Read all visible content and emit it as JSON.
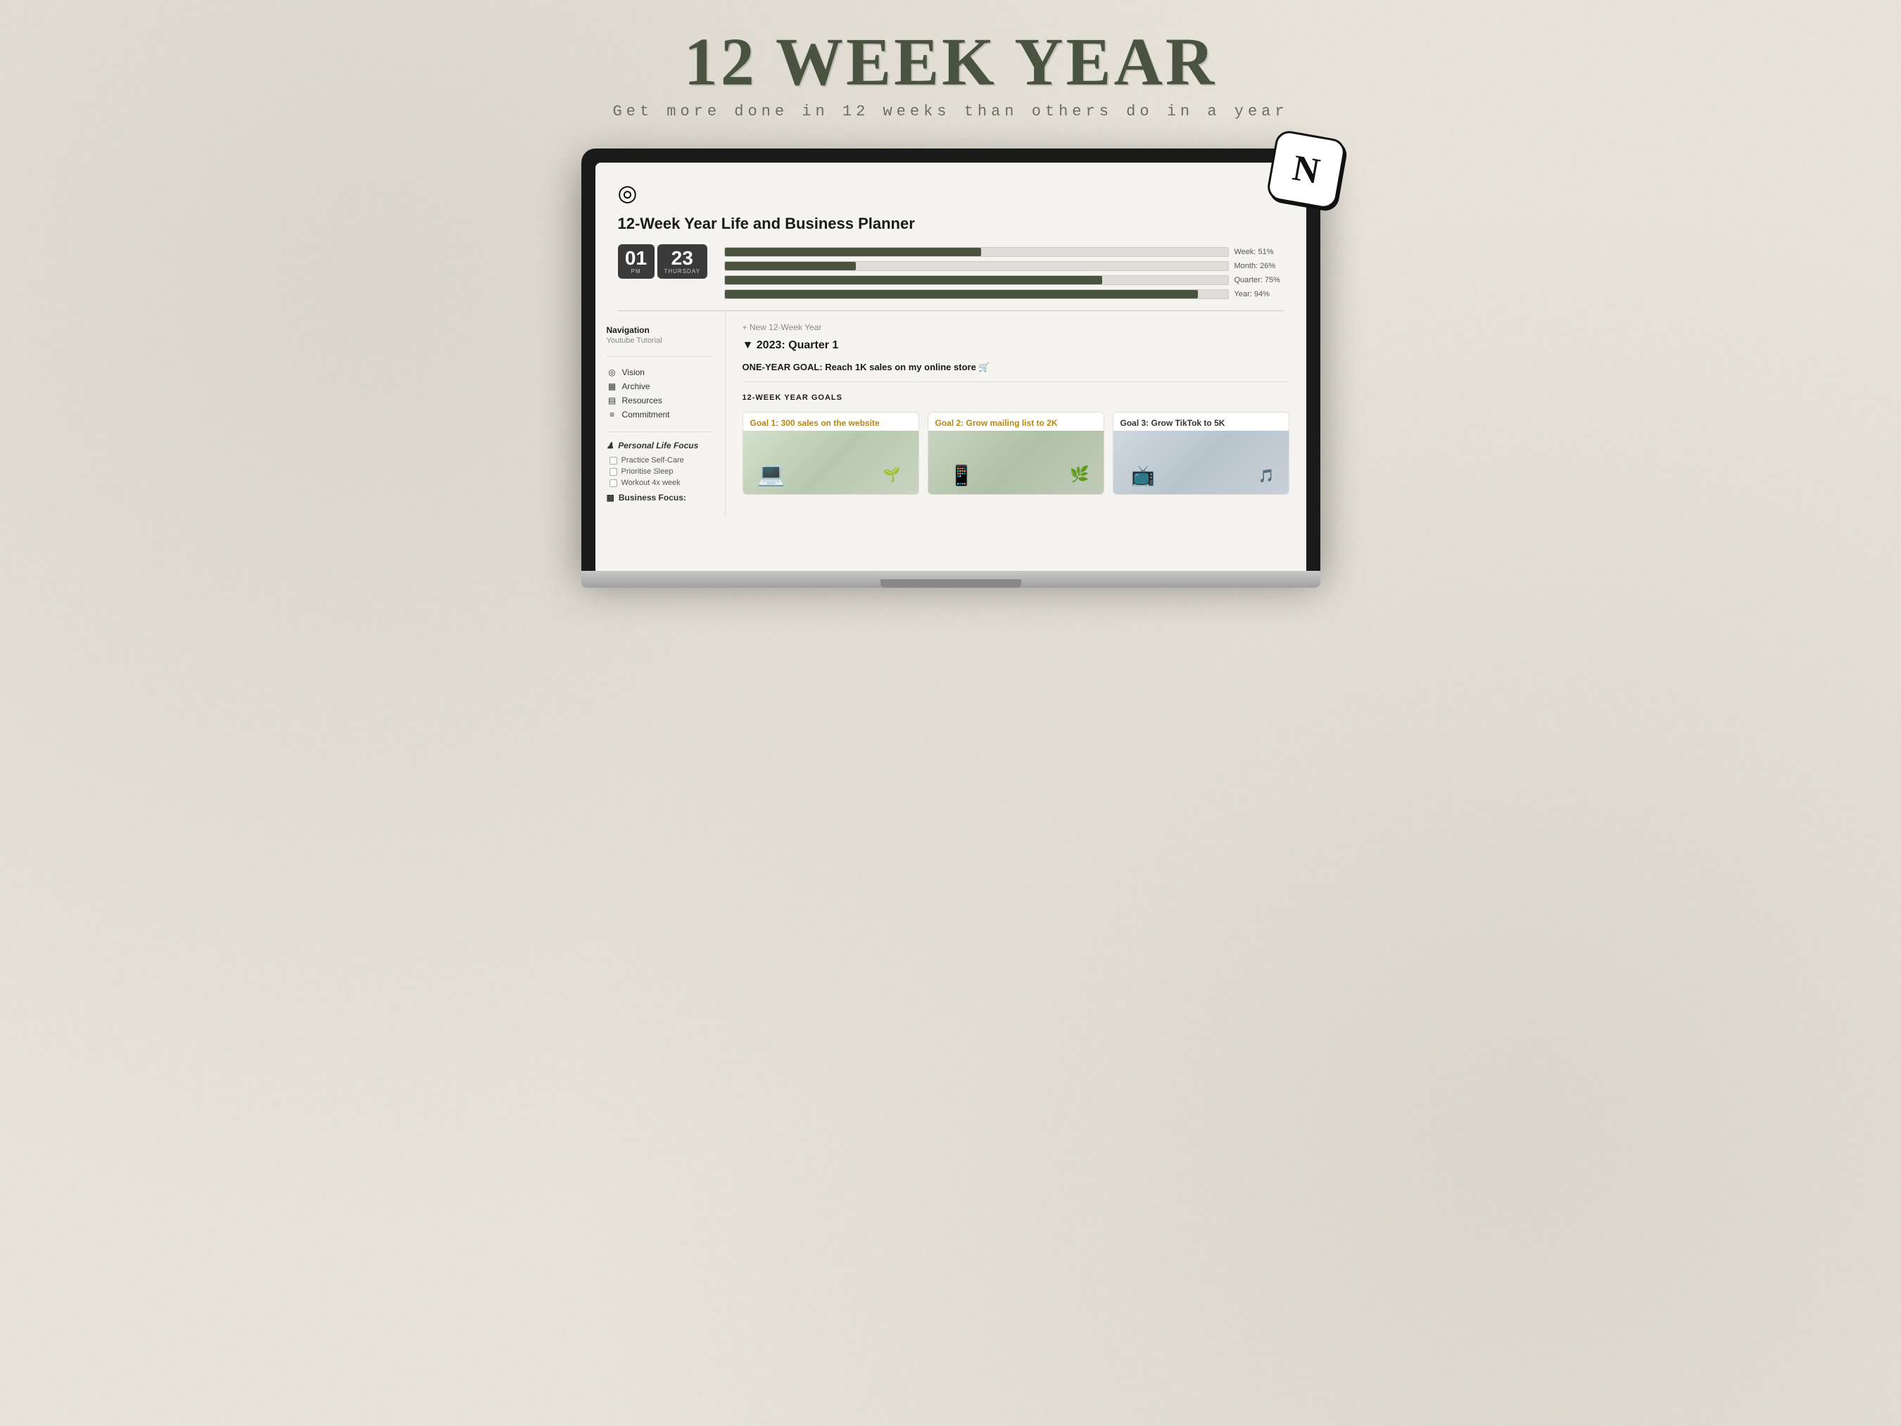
{
  "header": {
    "main_title": "12 WEEK YEAR",
    "subtitle": "Get more done in 12 weeks than others do in a year"
  },
  "notion_badge": "N",
  "app": {
    "target_icon": "◎",
    "title": "12-Week Year  Life and Business Planner",
    "clock": {
      "hour": "01",
      "hour_label": "PM",
      "minute": "23",
      "minute_label": "THURSDAY"
    },
    "progress": [
      {
        "label": "Week: 51%",
        "percent": 51
      },
      {
        "label": "Month: 26%",
        "percent": 26
      },
      {
        "label": "Quarter: 75%",
        "percent": 75
      },
      {
        "label": "Year: 94%",
        "percent": 94
      }
    ],
    "sidebar": {
      "nav_heading": "Navigation",
      "nav_subheading": "Youtube Tutorial",
      "items": [
        {
          "icon": "◎",
          "label": "Vision"
        },
        {
          "icon": "▦",
          "label": "Archive"
        },
        {
          "icon": "▤",
          "label": "Resources"
        },
        {
          "icon": "≡",
          "label": "Commitment"
        }
      ],
      "personal_life_focus": {
        "title": "Personal Life Focus",
        "icon": "♟",
        "items": [
          "Practice Self-Care",
          "Prioritise Sleep",
          "Workout 4x week"
        ]
      },
      "business_focus": {
        "title": "Business Focus:",
        "icon": "▦"
      }
    },
    "content": {
      "new_link": "+ New 12-Week Year",
      "quarter": "2023: Quarter 1",
      "one_year_goal": "ONE-YEAR GOAL: Reach 1K sales on my online store 🛒",
      "goals_heading": "12-WEEK YEAR GOALS",
      "goal_cards": [
        {
          "title": "Goal 1: 300 sales on the website",
          "title_color": "amber",
          "image_class": "img-goal1"
        },
        {
          "title": "Goal 2: Grow mailing list to 2K",
          "title_color": "amber",
          "image_class": "img-goal2"
        },
        {
          "title": "Goal 3: Grow TikTok to 5K",
          "title_color": "dark",
          "image_class": "img-goal3"
        }
      ]
    }
  }
}
